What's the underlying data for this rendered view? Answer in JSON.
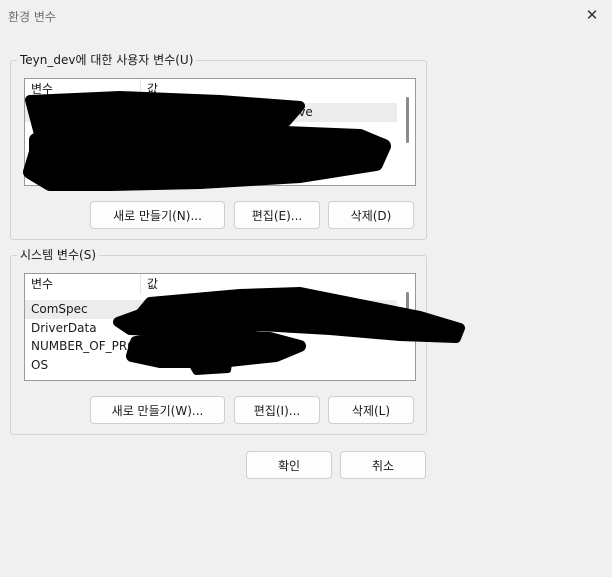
{
  "window": {
    "title": "환경 변수",
    "close_glyph": "✕"
  },
  "user_vars": {
    "legend": "Teyn_dev에 대한 사용자 변수(U)",
    "col_name": "변수",
    "col_value": "값",
    "rows": [
      {
        "name": "",
        "value": "ive"
      },
      {
        "name": "",
        "value": ""
      }
    ],
    "new_button": "새로 만들기(N)...",
    "edit_button": "편집(E)...",
    "delete_button": "삭제(D)"
  },
  "system_vars": {
    "legend": "시스템 변수(S)",
    "col_name": "변수",
    "col_value": "값",
    "rows": [
      {
        "name": "ComSpec",
        "value": ""
      },
      {
        "name": "DriverData",
        "value": ""
      },
      {
        "name": "NUMBER_OF_PRO...",
        "value": ""
      },
      {
        "name": "OS",
        "value": ""
      }
    ],
    "new_button": "새로 만들기(W)...",
    "edit_button": "편집(I)...",
    "delete_button": "삭제(L)"
  },
  "footer": {
    "ok_button": "확인",
    "cancel_button": "취소"
  }
}
